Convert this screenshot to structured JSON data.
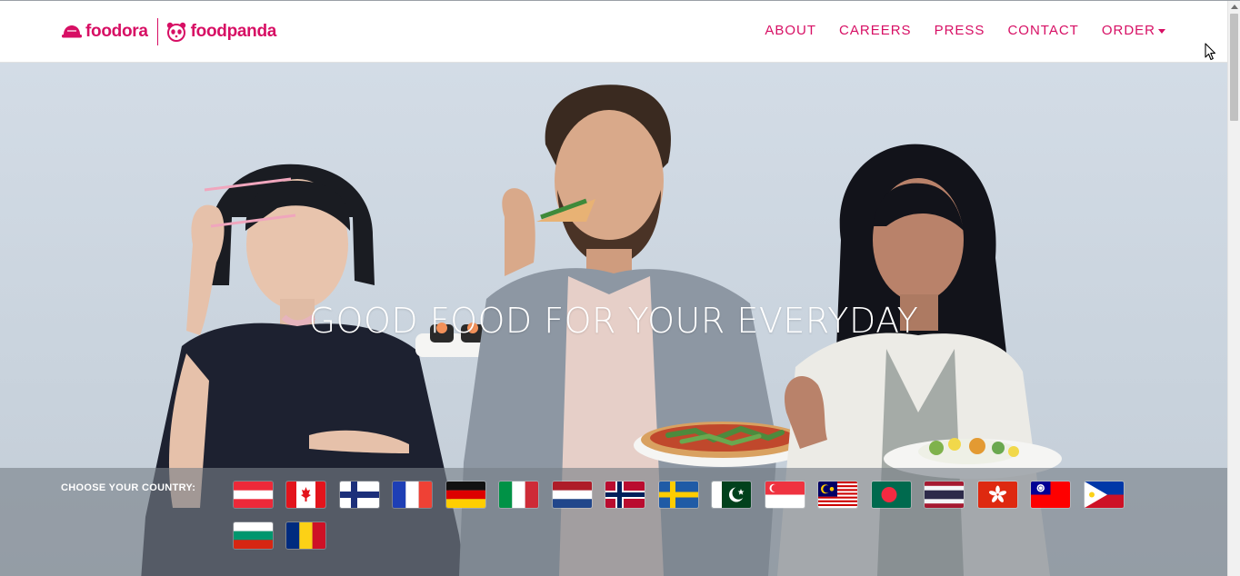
{
  "brand": {
    "foodora": "foodora",
    "foodpanda": "foodpanda",
    "color": "#d70f64"
  },
  "nav": {
    "about": "ABOUT",
    "careers": "CAREERS",
    "press": "PRESS",
    "contact": "CONTACT",
    "order": "ORDER"
  },
  "hero": {
    "title": "GOOD FOOD FOR YOUR EVERYDAY"
  },
  "countries": {
    "label": "CHOOSE YOUR COUNTRY:",
    "flags": [
      "austria-flag",
      "canada-flag",
      "finland-flag",
      "france-flag",
      "germany-flag",
      "italy-flag",
      "netherlands-flag",
      "norway-flag",
      "sweden-flag",
      "pakistan-flag",
      "singapore-flag",
      "malaysia-flag",
      "bangladesh-flag",
      "thailand-flag",
      "hong-kong-flag",
      "taiwan-flag",
      "philippines-flag",
      "bulgaria-flag",
      "romania-flag"
    ]
  }
}
